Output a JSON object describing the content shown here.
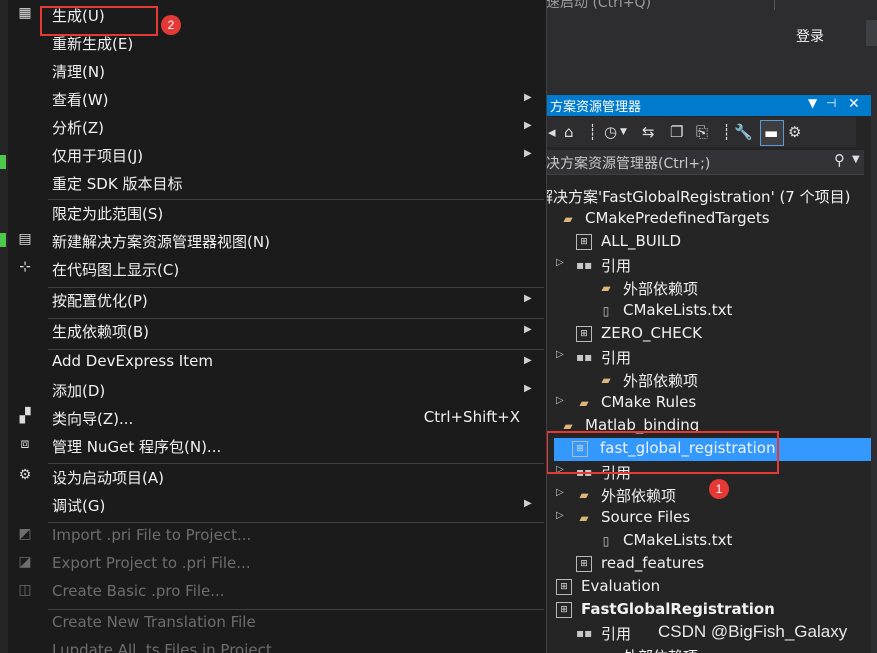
{
  "titlebar": {
    "search_hint": "速启动 (Ctrl+Q)",
    "minimize": "—",
    "login": "登录"
  },
  "context_menu": {
    "items": [
      {
        "label": "生成(U)",
        "icon": "build-icon"
      },
      {
        "label": "重新生成(E)"
      },
      {
        "label": "清理(N)"
      },
      {
        "label": "查看(W)",
        "submenu": true
      },
      {
        "label": "分析(Z)",
        "submenu": true
      },
      {
        "label": "仅用于项目(J)",
        "submenu": true
      },
      {
        "label": "重定 SDK 版本目标"
      },
      {
        "label": "限定为此范围(S)"
      },
      {
        "label": "新建解决方案资源管理器视图(N)",
        "icon": "new-view-icon"
      },
      {
        "label": "在代码图上显示(C)",
        "icon": "code-map-icon"
      },
      {
        "label": "按配置优化(P)",
        "submenu": true
      },
      {
        "label": "生成依赖项(B)",
        "submenu": true
      },
      {
        "label": "Add DevExpress Item",
        "submenu": true
      },
      {
        "label": "添加(D)",
        "submenu": true
      },
      {
        "label": "类向导(Z)...",
        "shortcut": "Ctrl+Shift+X",
        "icon": "class-wizard-icon"
      },
      {
        "label": "管理 NuGet 程序包(N)...",
        "icon": "nuget-icon"
      },
      {
        "label": "设为启动项目(A)",
        "icon": "gear-icon"
      },
      {
        "label": "调试(G)",
        "submenu": true
      },
      {
        "label": "Import .pri File to Project...",
        "disabled": true,
        "icon": "qt-import-icon"
      },
      {
        "label": "Export Project to .pri File...",
        "disabled": true,
        "icon": "qt-export-icon"
      },
      {
        "label": "Create Basic .pro File...",
        "disabled": true,
        "icon": "qt-create-icon"
      },
      {
        "label": "Create New Translation File",
        "disabled": true
      },
      {
        "label": "Lupdate All .ts Files in Project",
        "disabled": true
      }
    ]
  },
  "solution_explorer": {
    "title": "方案资源管理器",
    "search_placeholder": "决方案资源管理器(Ctrl+;)",
    "tree": [
      {
        "label": "解决方案'FastGlobalRegistration' (7 个项目)"
      },
      {
        "label": "CMakePredefinedTargets",
        "icon": "folder-icon"
      },
      {
        "label": "ALL_BUILD",
        "icon": "project-icon"
      },
      {
        "label": "引用",
        "icon": "references-icon",
        "arrow": true
      },
      {
        "label": "外部依赖项",
        "icon": "folder-icon"
      },
      {
        "label": "CMakeLists.txt",
        "icon": "file-icon"
      },
      {
        "label": "ZERO_CHECK",
        "icon": "project-icon"
      },
      {
        "label": "引用",
        "icon": "references-icon",
        "arrow": true
      },
      {
        "label": "外部依赖项",
        "icon": "folder-icon"
      },
      {
        "label": "CMake Rules",
        "icon": "folder-icon",
        "arrow": true
      },
      {
        "label": "Matlab_binding",
        "icon": "folder-icon"
      },
      {
        "label": "fast_global_registration",
        "icon": "project-icon",
        "selected": true
      },
      {
        "label": "引用",
        "icon": "references-icon",
        "arrow": true
      },
      {
        "label": "外部依赖项",
        "icon": "folder-icon",
        "arrow": true
      },
      {
        "label": "Source Files",
        "icon": "folder-icon",
        "arrow": true
      },
      {
        "label": "CMakeLists.txt",
        "icon": "file-icon"
      },
      {
        "label": "read_features",
        "icon": "project-icon"
      },
      {
        "label": "Evaluation",
        "icon": "project-icon"
      },
      {
        "label": "FastGlobalRegistration",
        "icon": "project-icon",
        "bold": true
      },
      {
        "label": "引用",
        "icon": "references-icon"
      },
      {
        "label": "外部依赖项",
        "icon": "folder-icon"
      }
    ]
  },
  "annotations": {
    "badge_1": "1",
    "badge_2": "2"
  },
  "watermark": "CSDN @BigFish_Galaxy",
  "colors": {
    "accent": "#007acc",
    "selection": "#3399ff",
    "highlight": "#e53935",
    "menu_bg": "#1b1b1c"
  }
}
